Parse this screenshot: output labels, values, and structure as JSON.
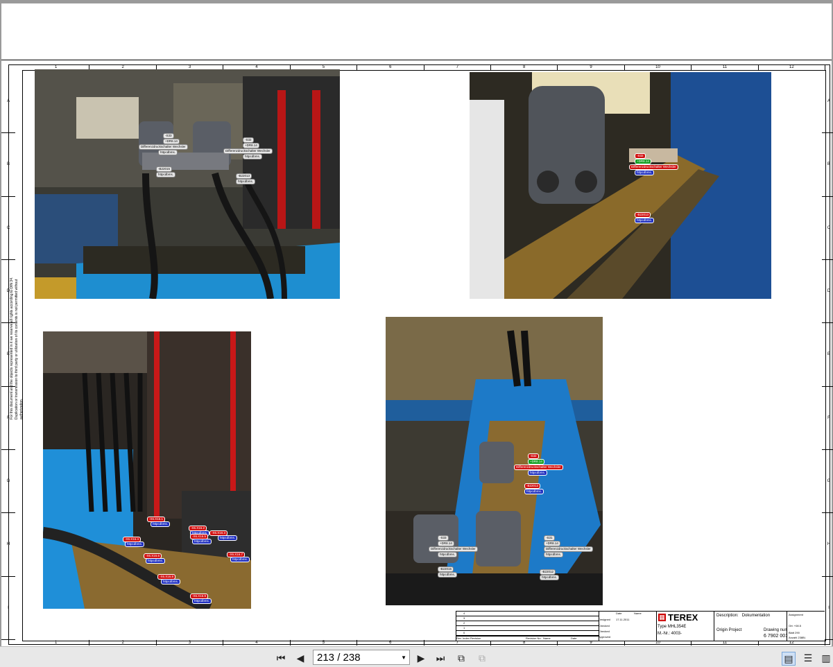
{
  "ruler": {
    "columns": [
      "1",
      "2",
      "3",
      "4",
      "5",
      "6",
      "7",
      "8",
      "9",
      "10",
      "11",
      "12"
    ],
    "rows": [
      "A",
      "B",
      "C",
      "D",
      "E",
      "F",
      "G",
      "H",
      "I"
    ]
  },
  "sidenote": "For this document and the objects represented in it we reserve all rights according to DIN 34. Duplication or transmission to third party or utilization of its contents is not permitted without authorization.",
  "photo1_labels": [
    {
      "text": "-S33",
      "c": "w"
    },
    {
      "text": "+DR8.14",
      "c": "w"
    },
    {
      "text": "Differenzdruckschalter Wechsler",
      "c": "w"
    },
    {
      "text": "httpcdbms.",
      "c": "w"
    },
    {
      "text": "-S32",
      "c": "w"
    },
    {
      "text": "+DR8.14",
      "c": "w"
    },
    {
      "text": "Differenzdruckschalter Wechsler",
      "c": "w"
    },
    {
      "text": "httpcdbms.",
      "c": "w"
    },
    {
      "text": "-B22015",
      "c": "w"
    },
    {
      "text": "httpcdbms.",
      "c": "w"
    },
    {
      "text": "-B22013",
      "c": "w"
    },
    {
      "text": "httpcdbms.",
      "c": "w"
    }
  ],
  "photo2_labels": [
    {
      "text": "-S32",
      "c": "r"
    },
    {
      "text": "+DR8.14",
      "c": "g"
    },
    {
      "text": "Differenzdruckschalter Wechsler",
      "c": "r"
    },
    {
      "text": "httpcdbms.",
      "c": "b"
    },
    {
      "text": "-B22013",
      "c": "r"
    },
    {
      "text": "httpcdbms.",
      "c": "b"
    }
  ],
  "photo3_labels": [
    {
      "text": "-X6.X16.1",
      "c": "r"
    },
    {
      "text": "httpcdbms.",
      "c": "b"
    },
    {
      "text": "-X6.X16.2",
      "c": "r"
    },
    {
      "text": "httpcdbms.",
      "c": "b"
    },
    {
      "text": "-X6.X16.3",
      "c": "r"
    },
    {
      "text": "httpcdbms.",
      "c": "b"
    },
    {
      "text": "-X6.X16.4",
      "c": "r"
    },
    {
      "text": "httpcdbms.",
      "c": "b"
    },
    {
      "text": "-X6.X16.5",
      "c": "r"
    },
    {
      "text": "httpcdbms.",
      "c": "b"
    },
    {
      "text": "-X6.X16.6",
      "c": "r"
    },
    {
      "text": "httpcdbms.",
      "c": "b"
    },
    {
      "text": "-X6.X16.7",
      "c": "r"
    },
    {
      "text": "httpcdbms.",
      "c": "b"
    },
    {
      "text": "-X6.X16.8",
      "c": "r"
    },
    {
      "text": "httpcdbms.",
      "c": "b"
    },
    {
      "text": "-X6.X16.9",
      "c": "r"
    },
    {
      "text": "httpcdbms.",
      "c": "b"
    }
  ],
  "photo4_labels": [
    {
      "text": "-S32",
      "c": "r"
    },
    {
      "text": "+DR8.14",
      "c": "g"
    },
    {
      "text": "Differenzdruckschalter Wechsler",
      "c": "r"
    },
    {
      "text": "httpcdbms.",
      "c": "b"
    },
    {
      "text": "-B22013",
      "c": "r"
    },
    {
      "text": "httpcdbms.",
      "c": "b"
    },
    {
      "text": "-S33",
      "c": "w"
    },
    {
      "text": "+DR8.14",
      "c": "w"
    },
    {
      "text": "Differenzdruckschalter Wechsler",
      "c": "w"
    },
    {
      "text": "httpcdbms.",
      "c": "w"
    },
    {
      "text": "-B22015",
      "c": "w"
    },
    {
      "text": "httpcdbms.",
      "c": "w"
    },
    {
      "text": "-S31",
      "c": "w"
    },
    {
      "text": "+DR8.14",
      "c": "w"
    },
    {
      "text": "Differenzdruckschalter Wechsler",
      "c": "w"
    },
    {
      "text": "httpcdbms.",
      "c": "w"
    },
    {
      "text": "-B22012",
      "c": "w"
    },
    {
      "text": "httpcdbms.",
      "c": "w"
    }
  ],
  "titleblock": {
    "rev_rows": [
      "4",
      "3",
      "2",
      "1",
      "0"
    ],
    "rev_header": {
      "index": "Rev. Index",
      "revision": "Revision",
      "rev_no": "Revision No.",
      "name": "Name",
      "date": "Date"
    },
    "roles": [
      "Designed",
      "Checked",
      "Checked",
      "Approved"
    ],
    "date_header": "Date",
    "name_header": "Name",
    "designed_date": "17.11.2011",
    "company": "TEREX",
    "type_label": "Type",
    "type_value": "MHL354E",
    "mnr_label": "M.-Nr.:",
    "mnr_value": "4003-",
    "description_label": "Description:",
    "description_value": "Dokumentation",
    "project": "Origin Project",
    "drawing_number_label": "Drawing number",
    "drawing_number": "6 7902 001 17",
    "assignment": "Assignment",
    "ort_label": "Ort:",
    "ort_value": "+08.5",
    "blatt_label": "Blatt",
    "blatt_value": "290",
    "anzahl_label": "Anzahl",
    "anzahl_value": "238Bl."
  },
  "viewer": {
    "page_current": "213",
    "page_total": "238",
    "page_display": "213 / 238"
  }
}
